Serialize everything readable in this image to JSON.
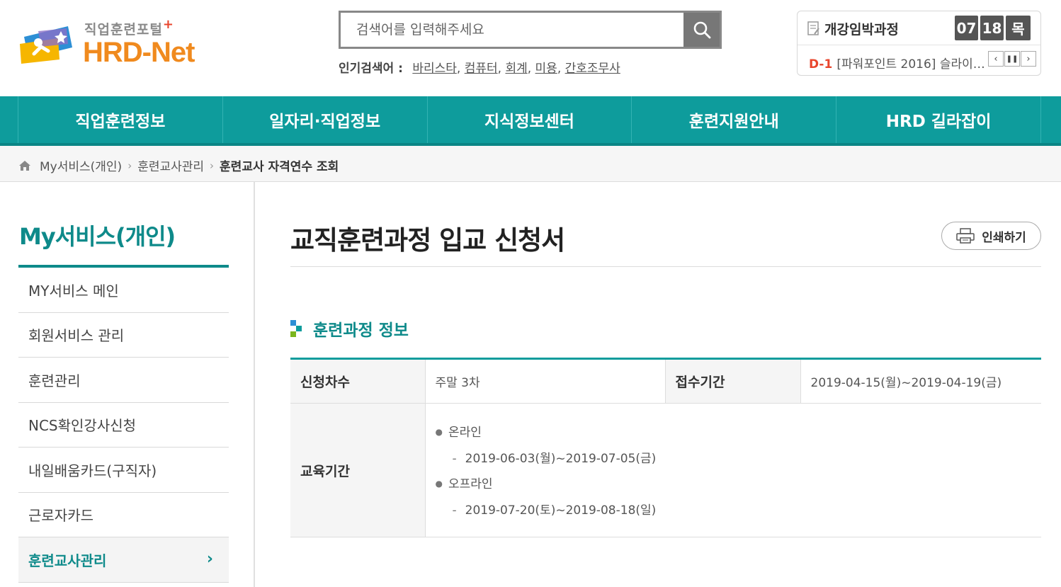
{
  "header": {
    "logo_sub": "직업훈련포털",
    "logo_plus": "+",
    "logo_main": "HRD-Net",
    "search": {
      "placeholder": "검색어를 입력해주세요"
    },
    "popular": {
      "label": "인기검색어 :",
      "keywords": [
        "바리스타",
        "컴퓨터",
        "회계",
        "미용",
        "간호조무사"
      ]
    },
    "upcoming": {
      "title": "개강임박과정",
      "month": "07",
      "day": "18",
      "weekday": "목",
      "dday": "D-1",
      "course": "[파워포인트 2016] 슬라이…"
    }
  },
  "gnb": {
    "items": [
      "직업훈련정보",
      "일자리·직업정보",
      "지식정보센터",
      "훈련지원안내",
      "HRD 길라잡이"
    ]
  },
  "breadcrumb": {
    "items": [
      "My서비스(개인)",
      "훈련교사관리"
    ],
    "current": "훈련교사 자격연수 조회"
  },
  "sidebar": {
    "title": "My서비스(개인)",
    "items": [
      {
        "label": "MY서비스 메인"
      },
      {
        "label": "회원서비스 관리"
      },
      {
        "label": "훈련관리"
      },
      {
        "label": "NCS확인강사신청"
      },
      {
        "label": "내일배움카드(구직자)"
      },
      {
        "label": "근로자카드"
      },
      {
        "label": "훈련교사관리",
        "active": true
      }
    ]
  },
  "main": {
    "page_title": "교직훈련과정 입교 신청서",
    "print_label": "인쇄하기",
    "section_title": "훈련과정 정보",
    "table": {
      "apply_round_label": "신청차수",
      "apply_round_value": "주말 3차",
      "receipt_period_label": "접수기간",
      "receipt_period_value": "2019-04-15(월)~2019-04-19(금)",
      "edu_period_label": "교육기간",
      "online_label": "온라인",
      "online_period": "2019-06-03(월)~2019-07-05(금)",
      "offline_label": "오프라인",
      "offline_period": "2019-07-20(토)~2019-08-18(일)"
    }
  },
  "colors": {
    "accent": "#0e9c9c",
    "accent_dark": "#0e8a8a",
    "logo_orange": "#f08a1e",
    "dday_red": "#e8452c"
  }
}
